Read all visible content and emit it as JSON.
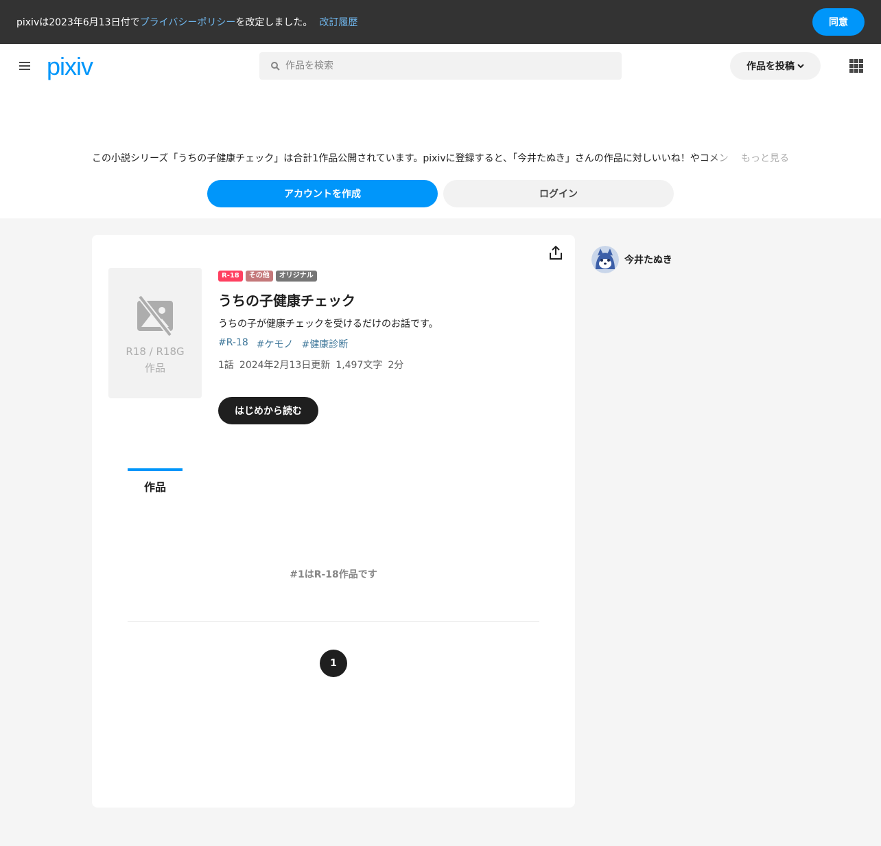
{
  "banner": {
    "text_before": "pixivは2023年6月13日付で",
    "policy_link": "プライバシーポリシー",
    "text_after": "を改定しました。",
    "history_link": "改訂履歴",
    "agree_label": "同意"
  },
  "header": {
    "logo": "pixiv",
    "search_placeholder": "作品を検索",
    "post_label": "作品を投稿"
  },
  "promo": {
    "text": "この小説シリーズ「うちの子健康チェック」は合計1作品公開されています。pixivに登録すると、「今井たぬき」さんの作品に対しいいね！やコメン",
    "more": "もっと見る",
    "create_account": "アカウントを作成",
    "login": "ログイン"
  },
  "series": {
    "cover_label_line1": "R18 / R18G",
    "cover_label_line2": "作品",
    "badges": [
      "R-18",
      "その他",
      "オリジナル"
    ],
    "title": "うちの子健康チェック",
    "description": "うちの子が健康チェックを受けるだけのお話です。",
    "tags": [
      "#R-18",
      "#ケモノ",
      "#健康診断"
    ],
    "meta": [
      "1話",
      "2024年2月13日更新",
      "1,497文字",
      "2分"
    ],
    "read_button": "はじめから読む",
    "tab_label": "作品",
    "r18_notice": "#1はR-18作品です",
    "current_page": "1"
  },
  "author": {
    "name": "今井たぬき"
  },
  "colors": {
    "accent": "#0096fa",
    "banner_bg": "#333333",
    "badge_r18": "#ff4060"
  }
}
